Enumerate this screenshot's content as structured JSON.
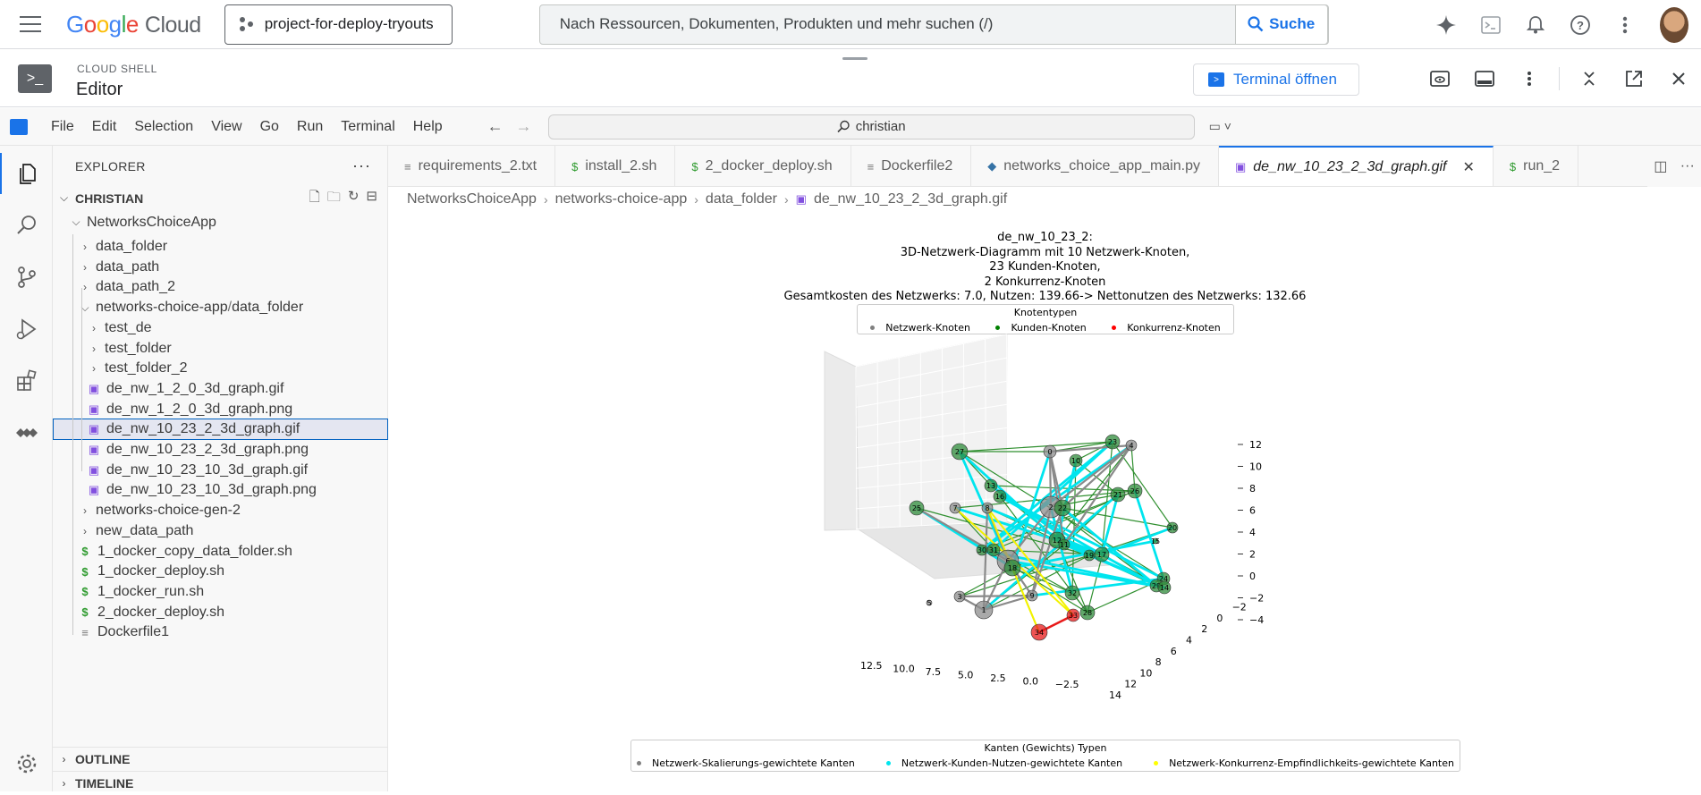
{
  "topbar": {
    "logo_google": "Google",
    "logo_cloud": "Cloud",
    "project": "project-for-deploy-tryouts",
    "search_placeholder": "Nach Ressourcen, Dokumenten, Produkten und mehr suchen (/)",
    "search_button": "Suche"
  },
  "shell": {
    "label": "CLOUD SHELL",
    "title": "Editor",
    "terminal_button": "Terminal öffnen"
  },
  "menu": {
    "items": [
      "File",
      "Edit",
      "Selection",
      "View",
      "Go",
      "Run",
      "Terminal",
      "Help"
    ],
    "command_center": "christian"
  },
  "explorer": {
    "header": "EXPLORER",
    "section": "CHRISTIAN",
    "project_folder": "NetworksChoiceApp",
    "partial_top": "data",
    "rows": [
      {
        "label": "data_folder",
        "type": "folder",
        "indent": 1
      },
      {
        "label": "data_path",
        "type": "folder",
        "indent": 1
      },
      {
        "label": "data_path_2",
        "type": "folder",
        "indent": 1
      },
      {
        "label": "networks-choice-app",
        "suffix": "data_folder",
        "type": "folder-open",
        "indent": 1
      },
      {
        "label": "test_de",
        "type": "folder",
        "indent": 2
      },
      {
        "label": "test_folder",
        "type": "folder",
        "indent": 2
      },
      {
        "label": "test_folder_2",
        "type": "folder",
        "indent": 2
      },
      {
        "label": "de_nw_1_2_0_3d_graph.gif",
        "type": "gif",
        "indent": 2
      },
      {
        "label": "de_nw_1_2_0_3d_graph.png",
        "type": "gif",
        "indent": 2
      },
      {
        "label": "de_nw_10_23_2_3d_graph.gif",
        "type": "gif",
        "indent": 2,
        "selected": true
      },
      {
        "label": "de_nw_10_23_2_3d_graph.png",
        "type": "gif",
        "indent": 2
      },
      {
        "label": "de_nw_10_23_10_3d_graph.gif",
        "type": "gif",
        "indent": 2
      },
      {
        "label": "de_nw_10_23_10_3d_graph.png",
        "type": "gif",
        "indent": 2
      },
      {
        "label": "networks-choice-gen-2",
        "type": "folder",
        "indent": 1
      },
      {
        "label": "new_data_path",
        "type": "folder",
        "indent": 1
      },
      {
        "label": "1_docker_copy_data_folder.sh",
        "type": "sh",
        "indent": 1
      },
      {
        "label": "1_docker_deploy.sh",
        "type": "sh",
        "indent": 1
      },
      {
        "label": "1_docker_run.sh",
        "type": "sh",
        "indent": 1
      },
      {
        "label": "2_docker_deploy.sh",
        "type": "sh",
        "indent": 1
      },
      {
        "label": "Dockerfile1",
        "type": "doc",
        "indent": 1
      }
    ],
    "outline": "OUTLINE",
    "timeline": "TIMELINE"
  },
  "tabs": [
    {
      "label": "requirements_2.txt",
      "icon": "doc"
    },
    {
      "label": "install_2.sh",
      "icon": "sh"
    },
    {
      "label": "2_docker_deploy.sh",
      "icon": "sh"
    },
    {
      "label": "Dockerfile2",
      "icon": "doc"
    },
    {
      "label": "networks_choice_app_main.py",
      "icon": "py"
    },
    {
      "label": "de_nw_10_23_2_3d_graph.gif",
      "icon": "gif",
      "active": true
    },
    {
      "label": "run_2",
      "icon": "sh"
    }
  ],
  "breadcrumb": [
    "NetworksChoiceApp",
    "networks-choice-app",
    "data_folder",
    "de_nw_10_23_2_3d_graph.gif"
  ],
  "graph": {
    "title_lines": [
      "de_nw_10_23_2:",
      "3D-Netzwerk-Diagramm mit 10 Netzwerk-Knoten,",
      "23 Kunden-Knoten,",
      "2 Konkurrenz-Knoten",
      "Gesamtkosten des Netzwerks: 7.0, Nutzen: 139.66-> Nettonutzen des Netzwerks: 132.66"
    ],
    "node_legend_title": "Knotentypen",
    "node_legend": [
      {
        "label": "Netzwerk-Knoten",
        "color": "#808080"
      },
      {
        "label": "Kunden-Knoten",
        "color": "#008000"
      },
      {
        "label": "Konkurrenz-Knoten",
        "color": "#ff0000"
      }
    ],
    "edge_legend_title": "Kanten (Gewichts) Typen",
    "edge_legend": [
      {
        "label": "Netzwerk-Skalierungs-gewichtete Kanten",
        "color": "#808080"
      },
      {
        "label": "Netzwerk-Kunden-Nutzen-gewichtete Kanten",
        "color": "#00e5ee"
      },
      {
        "label": "Netzwerk-Konkurrenz-Empfindlichkeits-gewichtete Kanten",
        "color": "#ffff00"
      }
    ],
    "z_ticks": [
      "12",
      "10",
      "8",
      "6",
      "4",
      "2",
      "0",
      "−2",
      "−4"
    ],
    "x_ticks": [
      "12.5",
      "10.0",
      "7.5",
      "5.0",
      "2.5",
      "0.0",
      "−2.5"
    ],
    "y_ticks": [
      "14",
      "12",
      "10",
      "8",
      "6",
      "4",
      "2",
      "0",
      "−2"
    ],
    "nodes": [
      {
        "label": "27",
        "kind": "customer"
      },
      {
        "label": "0",
        "kind": "network"
      },
      {
        "label": "23",
        "kind": "customer"
      },
      {
        "label": "4",
        "kind": "network"
      },
      {
        "label": "10",
        "kind": "customer"
      },
      {
        "label": "13",
        "kind": "customer"
      },
      {
        "label": "16",
        "kind": "customer"
      },
      {
        "label": "25",
        "kind": "customer"
      },
      {
        "label": "7",
        "kind": "network"
      },
      {
        "label": "8",
        "kind": "network"
      },
      {
        "label": "2",
        "kind": "network"
      },
      {
        "label": "22",
        "kind": "customer"
      },
      {
        "label": "21",
        "kind": "customer"
      },
      {
        "label": "26",
        "kind": "customer"
      },
      {
        "label": "20",
        "kind": "customer"
      },
      {
        "label": "12",
        "kind": "customer"
      },
      {
        "label": "11",
        "kind": "customer"
      },
      {
        "label": "31",
        "kind": "customer"
      },
      {
        "label": "6",
        "kind": "network"
      },
      {
        "label": "18",
        "kind": "customer"
      },
      {
        "label": "30",
        "kind": "customer"
      },
      {
        "label": "19",
        "kind": "customer"
      },
      {
        "label": "17",
        "kind": "customer"
      },
      {
        "label": "24",
        "kind": "customer"
      },
      {
        "label": "3",
        "kind": "network"
      },
      {
        "label": "9",
        "kind": "network"
      },
      {
        "label": "32",
        "kind": "customer"
      },
      {
        "label": "1",
        "kind": "network"
      },
      {
        "label": "28",
        "kind": "customer"
      },
      {
        "label": "33",
        "kind": "competitor"
      },
      {
        "label": "34",
        "kind": "competitor"
      },
      {
        "label": "5",
        "kind": "network"
      },
      {
        "label": "29",
        "kind": "customer"
      },
      {
        "label": "14",
        "kind": "customer"
      },
      {
        "label": "15",
        "kind": "customer"
      }
    ]
  }
}
